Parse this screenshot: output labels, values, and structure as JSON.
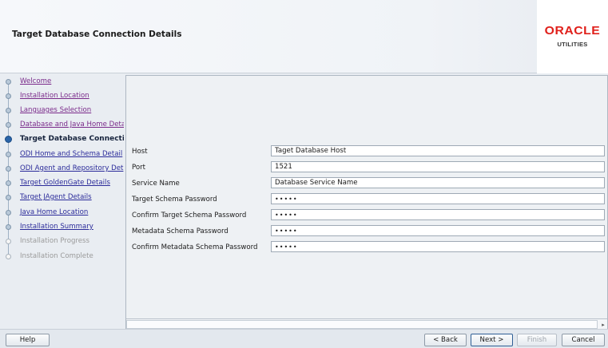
{
  "header": {
    "title": "Target Database Connection Details",
    "logo_main": "ORACLE",
    "logo_sub": "UTILITIES",
    "logo_color": "#e0201b"
  },
  "nav": {
    "items": [
      {
        "label": "Welcome",
        "state": "visited"
      },
      {
        "label": "Installation Location",
        "state": "visited"
      },
      {
        "label": "Languages Selection",
        "state": "visited"
      },
      {
        "label": "Database and Java Home Deta",
        "state": "visited"
      },
      {
        "label": "Target Database Connecti",
        "state": "current"
      },
      {
        "label": "ODI Home and Schema Detail",
        "state": "link"
      },
      {
        "label": "ODI Agent and Repository Det",
        "state": "link"
      },
      {
        "label": "Target GoldenGate Details",
        "state": "link"
      },
      {
        "label": "Target JAgent Details",
        "state": "link"
      },
      {
        "label": "Java Home Location",
        "state": "link"
      },
      {
        "label": "Installation Summary",
        "state": "link"
      },
      {
        "label": "Installation Progress",
        "state": "disabled"
      },
      {
        "label": "Installation Complete",
        "state": "disabled"
      }
    ]
  },
  "form": {
    "fields": [
      {
        "label": "Host",
        "value": "Taget Database Host"
      },
      {
        "label": "Port",
        "value": "1521"
      },
      {
        "label": "Service Name",
        "value": "Database Service Name"
      },
      {
        "label": "Target Schema Password",
        "value": "•••••"
      },
      {
        "label": "Confirm Target Schema Password",
        "value": "•••••"
      },
      {
        "label": "Metadata Schema Password",
        "value": "•••••"
      },
      {
        "label": "Confirm Metadata Schema Password",
        "value": "•••••"
      }
    ]
  },
  "footer": {
    "help": "Help",
    "back": "< Back",
    "next": "Next >",
    "finish": "Finish",
    "cancel": "Cancel"
  }
}
